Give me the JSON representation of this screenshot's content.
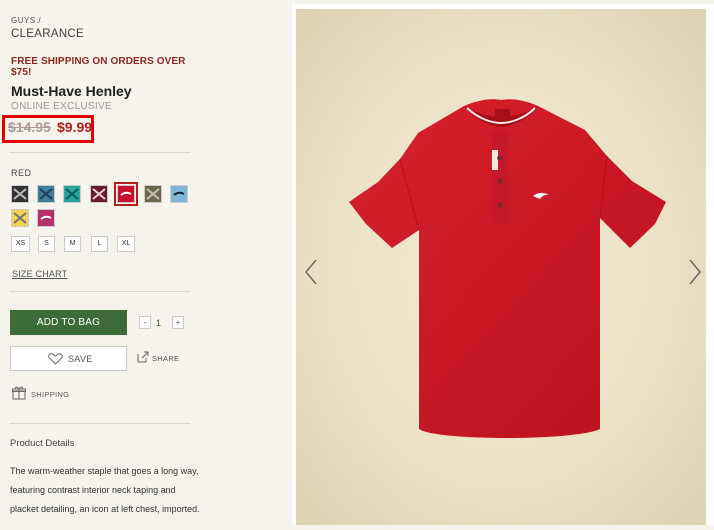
{
  "breadcrumb": {
    "parent": "GUYS /",
    "current": "CLEARANCE"
  },
  "promo": "FREE SHIPPING ON ORDERS OVER $75!",
  "product": {
    "title": "Must-Have Henley",
    "availability": "ONLINE EXCLUSIVE",
    "original_price": "$14.95",
    "sale_price": "$9.99"
  },
  "colors": {
    "selected_label": "RED",
    "swatches": [
      {
        "name": "black",
        "hex": "#333333"
      },
      {
        "name": "steel-blue",
        "hex": "#3f7d9a"
      },
      {
        "name": "teal",
        "hex": "#2aa39a"
      },
      {
        "name": "burgundy",
        "hex": "#6b1a2d"
      },
      {
        "name": "red",
        "hex": "#c8102e",
        "selected": true
      },
      {
        "name": "olive",
        "hex": "#6b6650"
      },
      {
        "name": "light-blue",
        "hex": "#7fb5d5"
      },
      {
        "name": "yellow",
        "hex": "#f1d35a"
      },
      {
        "name": "magenta",
        "hex": "#b4306a"
      }
    ]
  },
  "sizes": [
    "XS",
    "S",
    "M",
    "L",
    "XL"
  ],
  "size_chart": "SIZE CHART",
  "actions": {
    "add_to_bag": "ADD TO BAG",
    "quantity": "1",
    "minus": "-",
    "plus": "+",
    "save": "SAVE",
    "share": "SHARE",
    "shipping": "SHIPPING"
  },
  "details": {
    "heading": "Product Details",
    "description": "The warm-weather staple that goes a long way, featuring contrast interior neck taping and placket detailing, an icon at left chest, imported."
  },
  "accent_colors": {
    "sale": "#b01e1e",
    "button": "#3d6b3a",
    "highlight": "#e00000"
  }
}
